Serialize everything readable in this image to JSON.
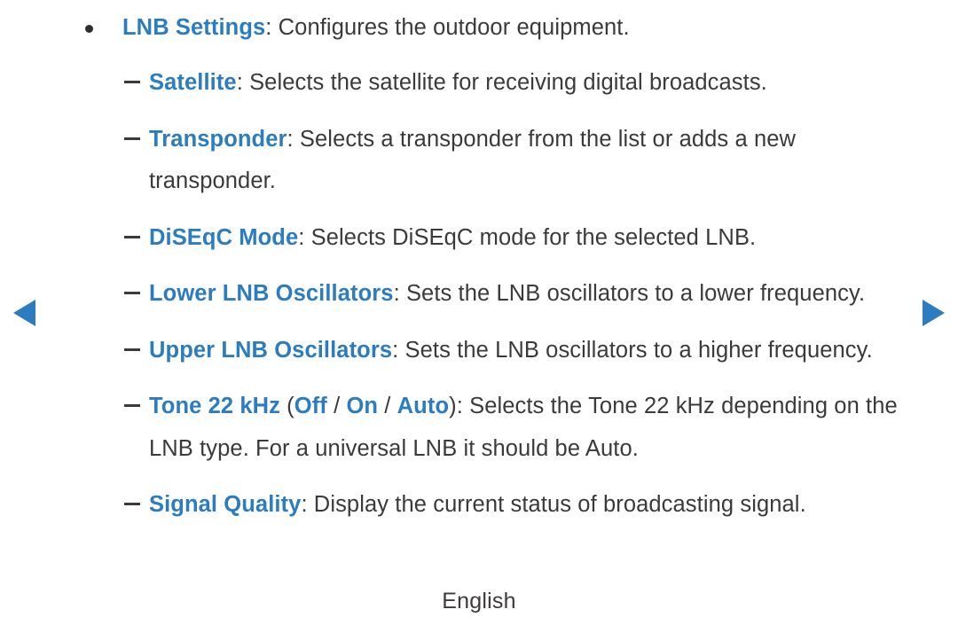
{
  "colors": {
    "accent_blue": "#2b7cc0",
    "body_text": "#3a3a3a",
    "background": "#ffffff"
  },
  "nav": {
    "prev_label": "previous-page-arrow",
    "next_label": "next-page-arrow"
  },
  "content": {
    "bullet": {
      "term": "LNB Settings",
      "description": ": Configures the outdoor equipment."
    },
    "sub_items": [
      {
        "term": "Satellite",
        "description": ": Selects the satellite for receiving digital broadcasts."
      },
      {
        "term": "Transponder",
        "description": ": Selects a transponder from the list or adds a new transponder."
      },
      {
        "term": "DiSEqC Mode",
        "description": ": Selects DiSEqC mode for the selected LNB."
      },
      {
        "term": "Lower LNB Oscillators",
        "description": ": Sets the LNB oscillators to a lower frequency."
      },
      {
        "term": "Upper LNB Oscillators",
        "description": ": Sets the LNB oscillators to a higher frequency."
      },
      {
        "term": "Tone 22 kHz",
        "options_open": " (",
        "option_1": "Off",
        "option_sep_1": " / ",
        "option_2": "On",
        "option_sep_2": " / ",
        "option_3": "Auto",
        "options_close": ")",
        "description": ": Selects the Tone 22 kHz depending on the LNB type. For a universal LNB it should be Auto."
      },
      {
        "term": "Signal Quality",
        "description": ": Display the current status of broadcasting signal."
      }
    ]
  },
  "footer": {
    "language": "English"
  }
}
